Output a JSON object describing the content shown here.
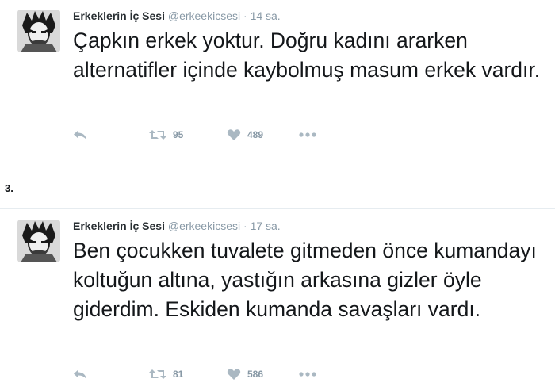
{
  "tweets": [
    {
      "name": "Erkeklerin İç Sesi",
      "handle": "@erkeekicsesi",
      "separator": "·",
      "time": "14 sa.",
      "text": "Çapkın erkek yoktur. Doğru kadını ararken alternatifler içinde kaybolmuş masum erkek vardır.",
      "retweets": "95",
      "likes": "489"
    },
    {
      "name": "Erkeklerin İç Sesi",
      "handle": "@erkeekicsesi",
      "separator": "·",
      "time": "17 sa.",
      "text": "Ben çocukken tuvalete gitmeden önce kumandayı koltuğun altına, yastığın arkasına gizler öyle giderdim. Eskiden kumanda savaşları vardı.",
      "retweets": "81",
      "likes": "586"
    }
  ],
  "section_number": "3.",
  "icons": {
    "reply": "reply-icon",
    "retweet": "retweet-icon",
    "like": "heart-icon",
    "more": "more-icon"
  },
  "colors": {
    "text": "#14171a",
    "muted": "#8899a6",
    "icon": "#aab8c2",
    "divider": "#e6ecf0"
  }
}
